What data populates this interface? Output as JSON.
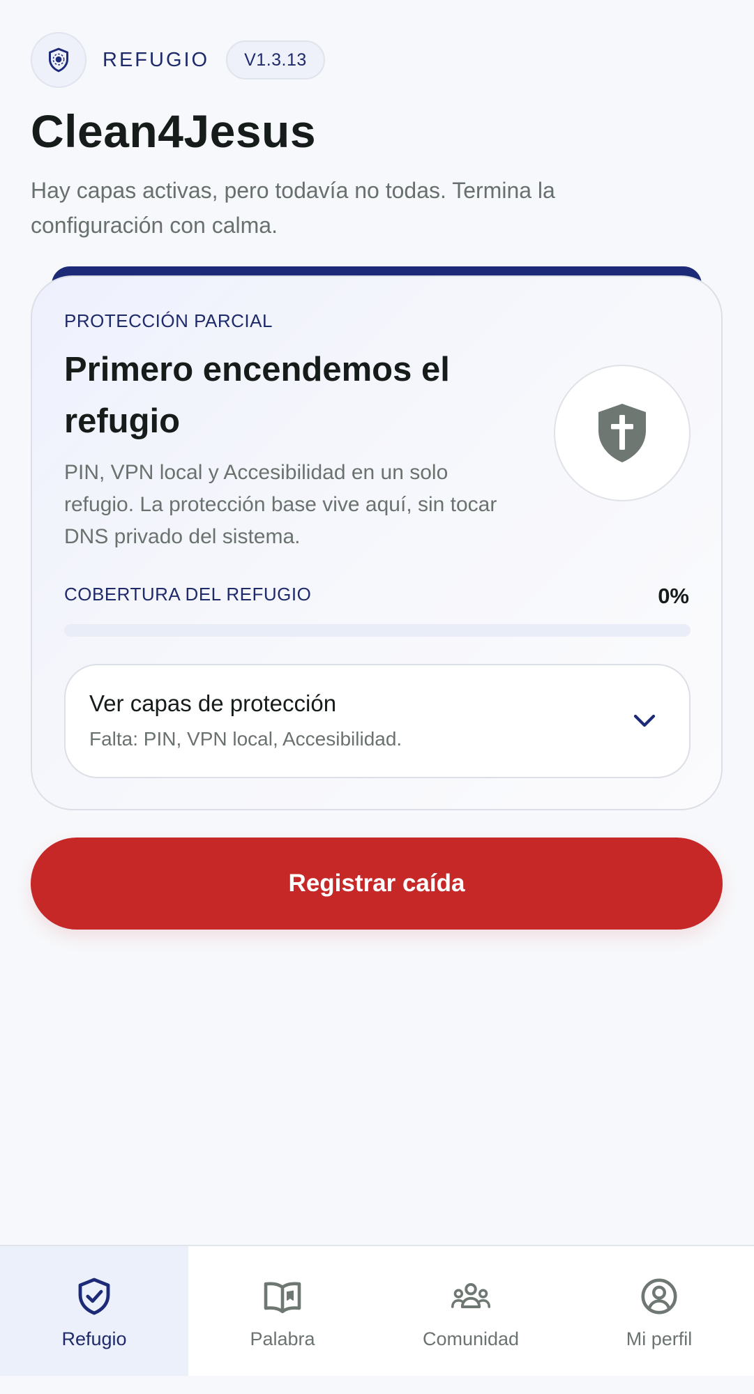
{
  "header": {
    "brand": "REFUGIO",
    "version": "V1.3.13",
    "title": "Clean4Jesus",
    "subtitle": "Hay capas activas, pero todavía no todas. Termina la configuración con calma."
  },
  "card": {
    "eyebrow": "PROTECCIÓN PARCIAL",
    "heading": "Primero encendemos el refugio",
    "body": "PIN, VPN local y Accesibilidad en un solo refugio. La protección base vive aquí, sin tocar DNS privado del sistema.",
    "status_icon": "shield-cross-icon",
    "coverage": {
      "label": "COBERTURA DEL REFUGIO",
      "value_text": "0%",
      "value": 0
    },
    "layers": {
      "title": "Ver capas de protección",
      "missing": "Falta: PIN, VPN local, Accesibilidad.",
      "icon": "chevron-down-icon"
    }
  },
  "actions": {
    "relapse_label": "Registrar caída"
  },
  "nav": {
    "items": [
      {
        "label": "Refugio",
        "icon": "shield-check-icon",
        "active": true
      },
      {
        "label": "Palabra",
        "icon": "open-book-icon",
        "active": false
      },
      {
        "label": "Comunidad",
        "icon": "community-icon",
        "active": false
      },
      {
        "label": "Mi perfil",
        "icon": "profile-icon",
        "active": false
      }
    ]
  },
  "colors": {
    "background": "#f7f8fb",
    "primary_navy": "#1d2a78",
    "danger": "#c62828",
    "shield_gray": "#6e7771",
    "text_dark": "#161c1a",
    "text_muted": "#6a726e",
    "nav_active_bg": "#ecf0fb"
  }
}
